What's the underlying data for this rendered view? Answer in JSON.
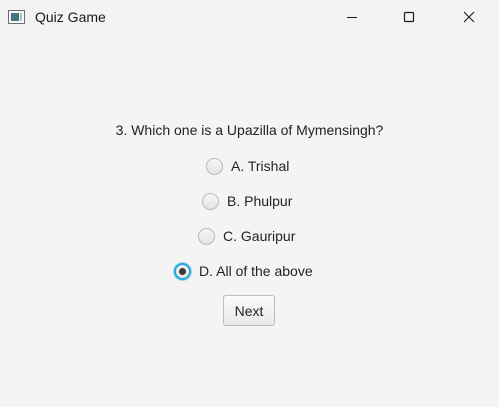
{
  "window": {
    "title": "Quiz Game"
  },
  "quiz": {
    "question": "3. Which one is a Upazilla of Mymensingh?",
    "options": [
      {
        "label": "A. Trishal",
        "selected": false
      },
      {
        "label": "B. Phulpur",
        "selected": false
      },
      {
        "label": "C. Gauripur",
        "selected": false
      },
      {
        "label": "D. All of the above",
        "selected": true
      }
    ],
    "next_label": "Next"
  },
  "colors": {
    "accent": "#27a4db",
    "background": "#f4f4f4"
  }
}
